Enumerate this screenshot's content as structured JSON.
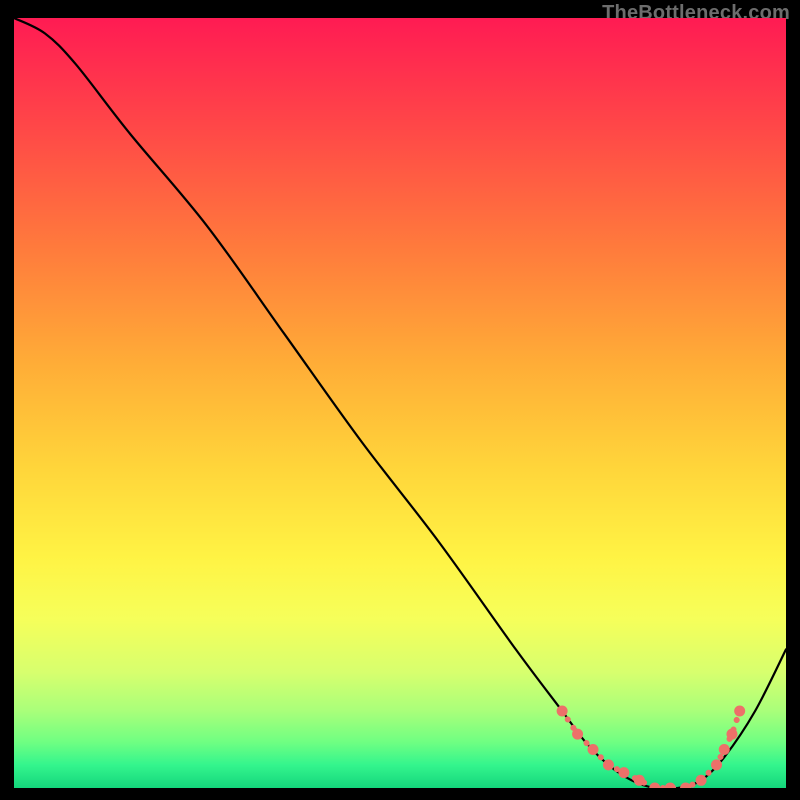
{
  "watermark": "TheBottleneck.com",
  "chart_data": {
    "type": "line",
    "title": "",
    "xlabel": "",
    "ylabel": "",
    "xlim": [
      0,
      100
    ],
    "ylim": [
      0,
      100
    ],
    "grid": false,
    "series": [
      {
        "name": "main-curve",
        "color": "#000000",
        "style": "solid",
        "x": [
          0,
          4,
          8,
          15,
          25,
          35,
          45,
          55,
          65,
          71,
          74,
          77,
          80,
          83,
          86,
          89,
          92,
          96,
          100
        ],
        "y": [
          100,
          98,
          94,
          85,
          73,
          59,
          45,
          32,
          18,
          10,
          6,
          3,
          1,
          0,
          0,
          1,
          4,
          10,
          18
        ]
      },
      {
        "name": "lower-markers",
        "color": "#ed7069",
        "style": "markers",
        "x": [
          71,
          73,
          75,
          77,
          79,
          81,
          83,
          85,
          87,
          89,
          91,
          92,
          93,
          94
        ],
        "y": [
          10,
          7,
          5,
          3,
          2,
          1,
          0,
          0,
          0,
          1,
          3,
          5,
          7,
          10
        ]
      }
    ],
    "background_gradient": {
      "stops": [
        {
          "t": 0.0,
          "color": "#ff1b53"
        },
        {
          "t": 0.15,
          "color": "#ff4a47"
        },
        {
          "t": 0.3,
          "color": "#ff7b3c"
        },
        {
          "t": 0.45,
          "color": "#ffad37"
        },
        {
          "t": 0.58,
          "color": "#ffd43a"
        },
        {
          "t": 0.7,
          "color": "#fff344"
        },
        {
          "t": 0.78,
          "color": "#f6ff5a"
        },
        {
          "t": 0.85,
          "color": "#d7ff6e"
        },
        {
          "t": 0.9,
          "color": "#a9ff7a"
        },
        {
          "t": 0.94,
          "color": "#70ff82"
        },
        {
          "t": 0.97,
          "color": "#34f58d"
        },
        {
          "t": 1.0,
          "color": "#14d67c"
        }
      ]
    }
  }
}
